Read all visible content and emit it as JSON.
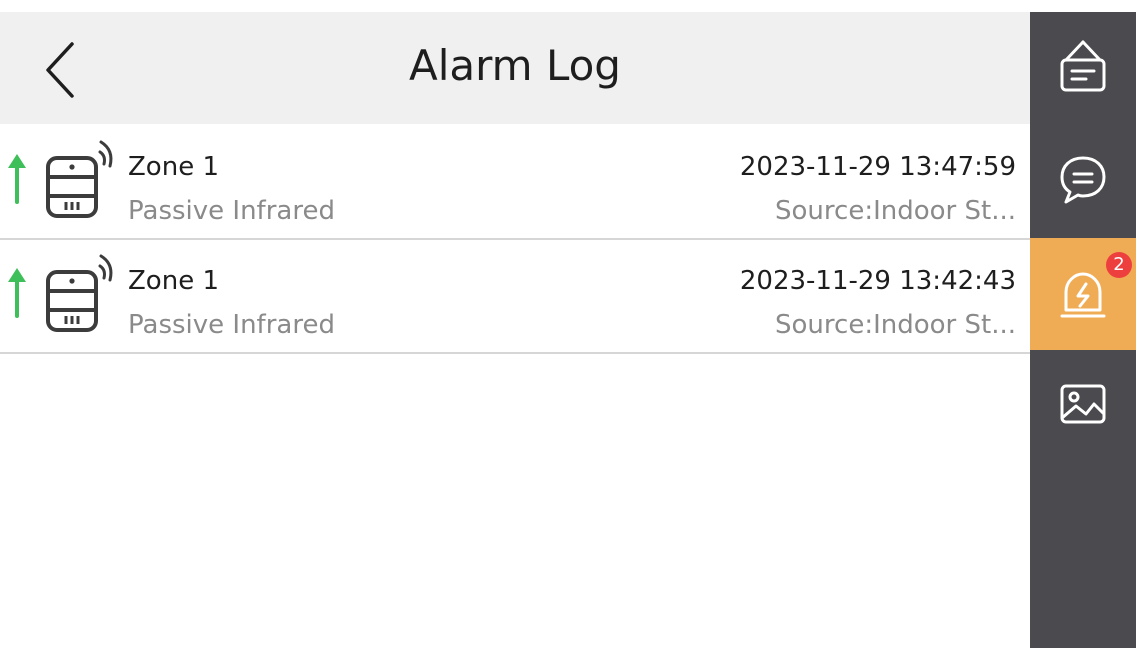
{
  "header": {
    "title": "Alarm Log",
    "back_icon": "chevron-left-icon"
  },
  "alarms": [
    {
      "zone": "Zone 1",
      "type": "Passive Infrared",
      "time": "2023-11-29 13:47:59",
      "source": "Source:Indoor St...",
      "arrow_icon": "arrow-up-icon",
      "sensor_icon": "pir-sensor-icon"
    },
    {
      "zone": "Zone 1",
      "type": "Passive Infrared",
      "time": "2023-11-29 13:42:43",
      "source": "Source:Indoor St...",
      "arrow_icon": "arrow-up-icon",
      "sensor_icon": "pir-sensor-icon"
    }
  ],
  "sidebar": {
    "items": [
      {
        "icon": "notice-icon",
        "active": false
      },
      {
        "icon": "message-icon",
        "active": false
      },
      {
        "icon": "alarm-icon",
        "active": true,
        "badge": "2"
      },
      {
        "icon": "picture-icon",
        "active": false
      }
    ]
  },
  "colors": {
    "header_bg": "#f0f0f0",
    "sidebar_bg": "#4a4a4f",
    "sidebar_active": "#f0ac54",
    "badge": "#ee3f3f",
    "arrow": "#3fbf5a",
    "primary_text": "#1e1e1e",
    "secondary_text": "#8a8a8a",
    "divider": "#d6d6d6"
  }
}
